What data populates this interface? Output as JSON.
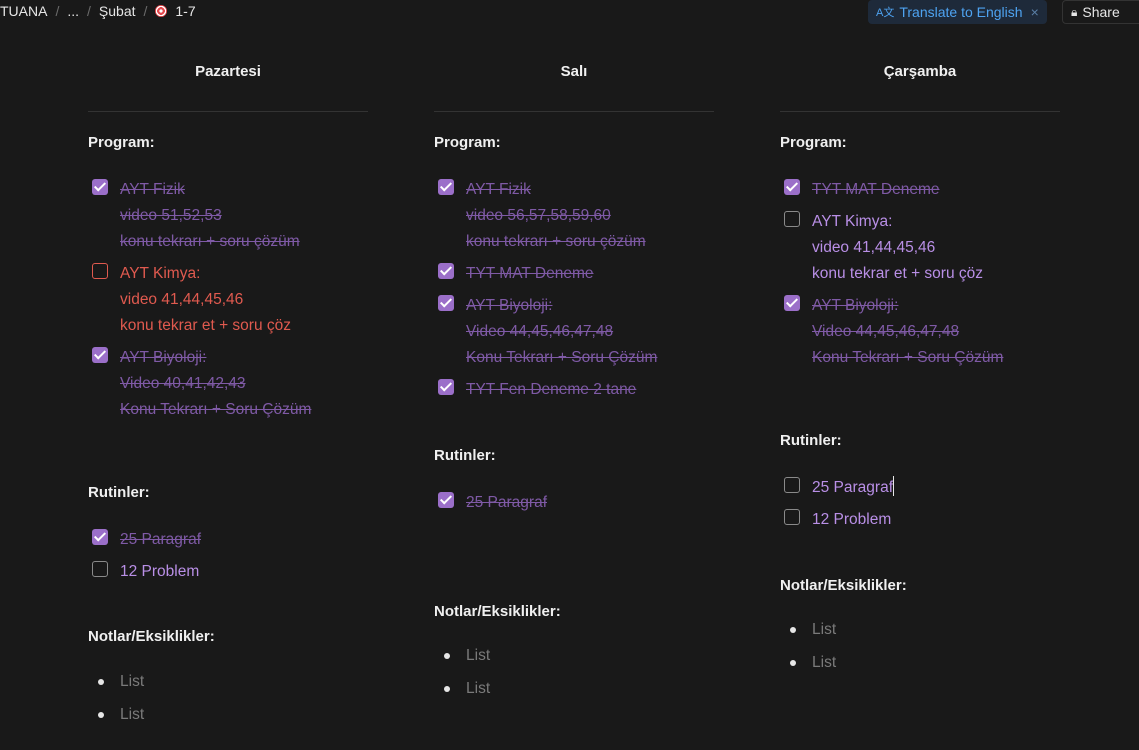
{
  "breadcrumb": {
    "root": "TUANA",
    "ellipsis": "...",
    "parent": "Şubat",
    "current": "1-7",
    "separator": "/"
  },
  "translate": {
    "icon": "A文",
    "label": "Translate to English",
    "close": "×"
  },
  "share": {
    "label": "Share"
  },
  "columns": [
    {
      "title": "Pazartesi",
      "program_heading": "Program:",
      "program": [
        {
          "checked": true,
          "lines": [
            "AYT Fizik",
            "video 51,52,53",
            "konu tekrarı + soru çözüm"
          ]
        },
        {
          "checked": false,
          "lines": [
            "AYT Kimya:",
            "video 41,44,45,46",
            "konu tekrar et + soru çöz"
          ]
        },
        {
          "checked": true,
          "lines": [
            "AYT Biyoloji:",
            "Video 40,41,42,43",
            "Konu Tekrarı + Soru Çözüm"
          ]
        }
      ],
      "routines_heading": "Rutinler:",
      "routines": [
        {
          "checked": true,
          "lines": [
            "25 Paragraf"
          ]
        },
        {
          "checked": false,
          "lines": [
            "12 Problem"
          ]
        }
      ],
      "notes_heading": "Notlar/Eksiklikler:",
      "notes": [
        "List",
        "List"
      ]
    },
    {
      "title": "Salı",
      "program_heading": "Program:",
      "program": [
        {
          "checked": true,
          "lines": [
            "AYT Fizik",
            "video 56,57,58,59,60",
            "konu tekrarı + soru çözüm"
          ]
        },
        {
          "checked": true,
          "lines": [
            "TYT MAT Deneme"
          ]
        },
        {
          "checked": true,
          "lines": [
            "AYT Biyoloji:",
            "Video 44,45,46,47,48",
            "Konu Tekrarı + Soru Çözüm"
          ]
        },
        {
          "checked": true,
          "lines": [
            "TYT Fen Deneme 2 tane"
          ]
        }
      ],
      "routines_heading": "Rutinler:",
      "routines": [
        {
          "checked": true,
          "lines": [
            "25 Paragraf"
          ]
        }
      ],
      "notes_heading": "Notlar/Eksiklikler:",
      "notes": [
        "List",
        "List"
      ]
    },
    {
      "title": "Çarşamba",
      "program_heading": "Program:",
      "program": [
        {
          "checked": true,
          "lines": [
            "TYT MAT Deneme"
          ]
        },
        {
          "checked": false,
          "lines": [
            "AYT Kimya:",
            "video 41,44,45,46",
            "konu tekrar et + soru çöz"
          ]
        },
        {
          "checked": true,
          "lines": [
            "AYT Biyoloji:",
            "Video 44,45,46,47,48",
            "Konu Tekrarı + Soru Çözüm"
          ]
        }
      ],
      "routines_heading": "Rutinler:",
      "routines": [
        {
          "checked": false,
          "lines": [
            "25 Paragraf"
          ]
        },
        {
          "checked": false,
          "lines": [
            "12 Problem"
          ]
        }
      ],
      "notes_heading": "Notlar/Eksiklikler:",
      "notes": [
        "List",
        "List"
      ]
    }
  ],
  "colors": {
    "background": "#191919",
    "checked_box": "#9b6fc9",
    "done_text": "#7f5aa6",
    "todo_text": "#b98fe6",
    "red_text": "#e05a4f",
    "translate_text": "#4ea3f1"
  }
}
